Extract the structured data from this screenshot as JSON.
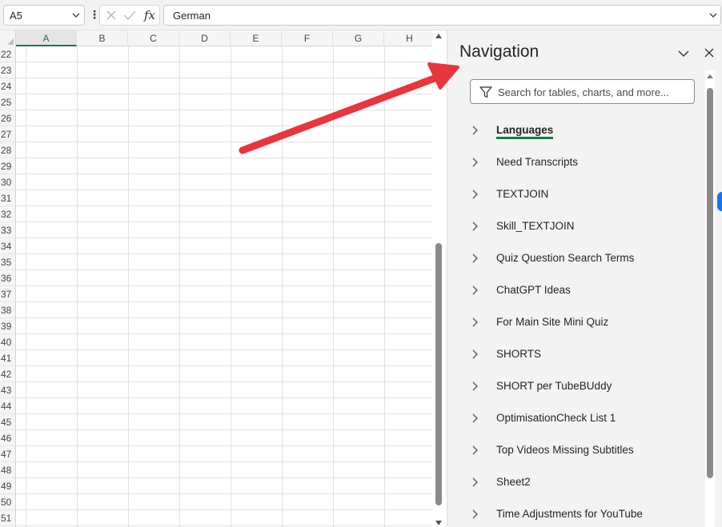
{
  "formula_bar": {
    "name_box": "A5",
    "fx_symbol": "fx",
    "formula_value": "German"
  },
  "grid": {
    "columns": [
      "A",
      "B",
      "C",
      "D",
      "E",
      "F",
      "G",
      "H"
    ],
    "selected_column": "A",
    "rows": [
      "22",
      "23",
      "24",
      "25",
      "26",
      "27",
      "28",
      "29",
      "30",
      "31",
      "32",
      "33",
      "34",
      "35",
      "36",
      "37",
      "38",
      "39",
      "40",
      "41",
      "42",
      "43",
      "44",
      "45",
      "46",
      "47",
      "48",
      "49",
      "50",
      "51"
    ]
  },
  "navigation": {
    "title": "Navigation",
    "search_placeholder": "Search for tables, charts, and more...",
    "items": [
      {
        "label": "Languages",
        "active": true
      },
      {
        "label": "Need Transcripts"
      },
      {
        "label": "TEXTJOIN"
      },
      {
        "label": "Skill_TEXTJOIN"
      },
      {
        "label": "Quiz Question Search Terms"
      },
      {
        "label": "ChatGPT Ideas"
      },
      {
        "label": "For Main Site Mini Quiz"
      },
      {
        "label": "SHORTS"
      },
      {
        "label": "SHORT per TubeBUddy"
      },
      {
        "label": "OptimisationCheck List 1"
      },
      {
        "label": "Top Videos Missing Subtitles"
      },
      {
        "label": "Sheet2"
      },
      {
        "label": "Time Adjustments for YouTube"
      }
    ]
  },
  "colors": {
    "accent_green": "#107c41",
    "annotation_arrow": "#e8363c"
  }
}
